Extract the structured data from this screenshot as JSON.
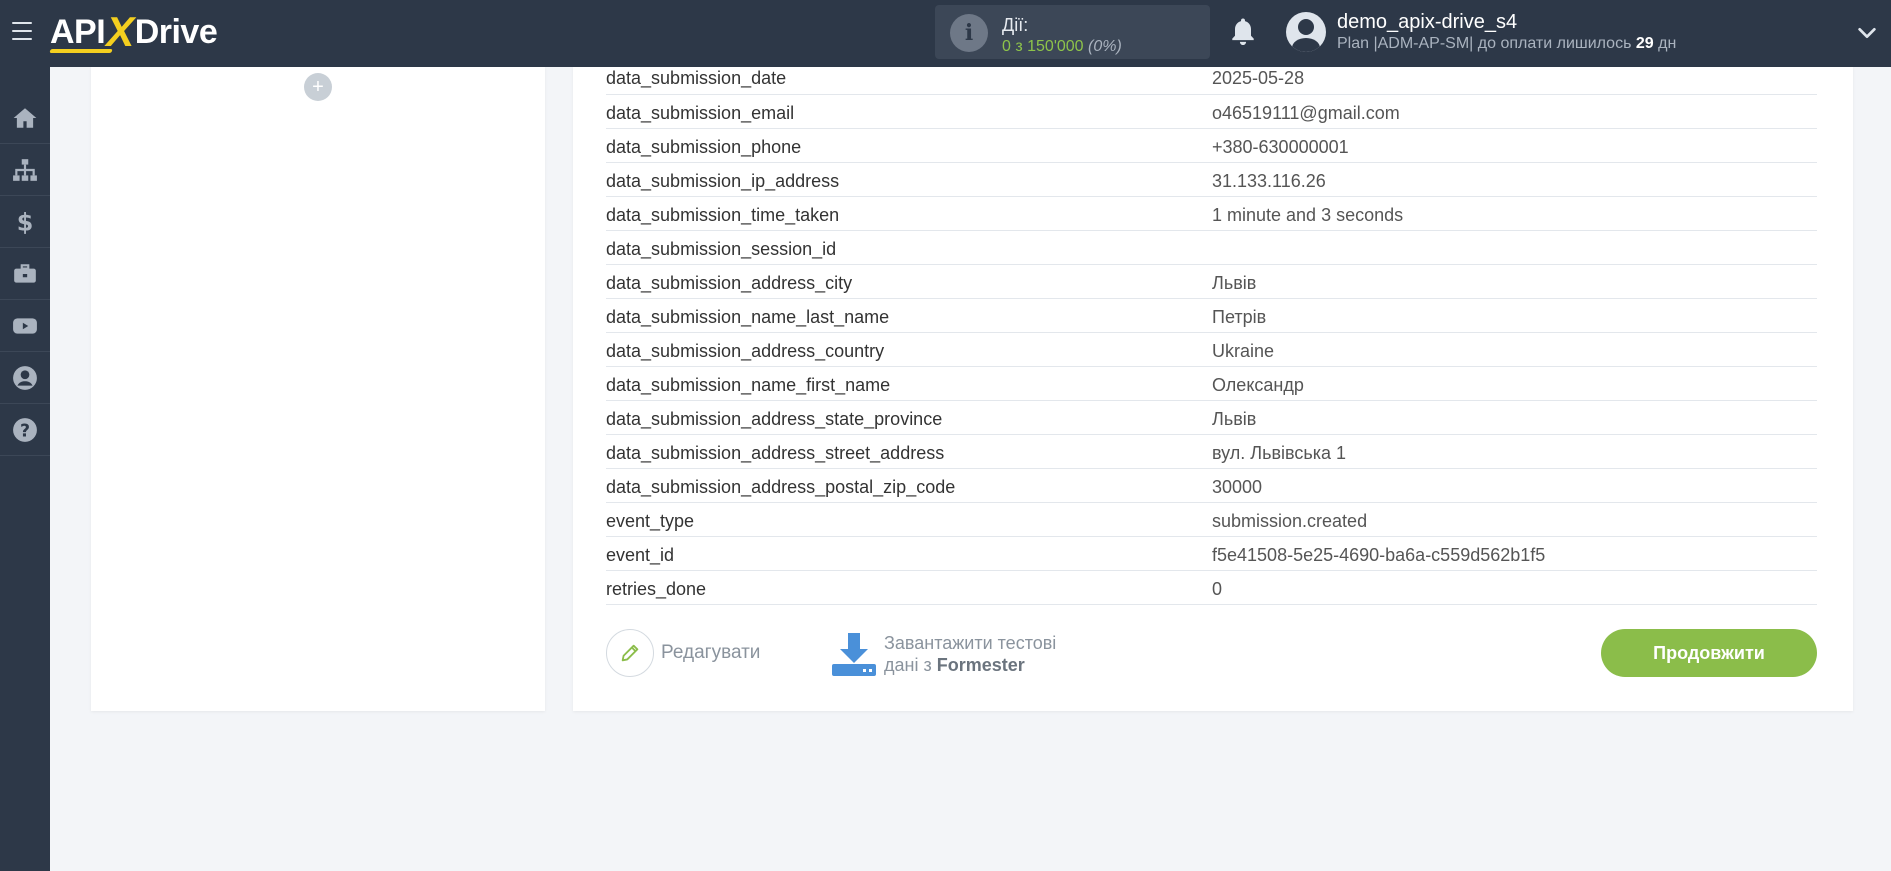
{
  "header": {
    "logo_api": "API",
    "logo_x": "X",
    "logo_drive": "Drive",
    "actions_title": "Дії:",
    "actions_count": "0 з 150'000",
    "actions_percent": "(0%)",
    "username": "demo_apix-drive_s4",
    "plan_prefix": "Plan |ADM-AP-SM| до оплати лишилось ",
    "plan_days": "29",
    "plan_suffix": " дн"
  },
  "sidebar": {
    "items": [
      {
        "icon": "home-icon"
      },
      {
        "icon": "sitemap-icon"
      },
      {
        "icon": "dollar-icon"
      },
      {
        "icon": "briefcase-icon"
      },
      {
        "icon": "youtube-icon"
      },
      {
        "icon": "user-icon"
      },
      {
        "icon": "help-icon"
      }
    ]
  },
  "left_panel": {
    "add_label": "+"
  },
  "table": {
    "rows": [
      {
        "key": "data_submission_date",
        "value": "2025-05-28"
      },
      {
        "key": "data_submission_email",
        "value": "o46519111@gmail.com"
      },
      {
        "key": "data_submission_phone",
        "value": "+380-630000001"
      },
      {
        "key": "data_submission_ip_address",
        "value": "31.133.116.26"
      },
      {
        "key": "data_submission_time_taken",
        "value": "1 minute and 3 seconds"
      },
      {
        "key": "data_submission_session_id",
        "value": ""
      },
      {
        "key": "data_submission_address_city",
        "value": "Львів"
      },
      {
        "key": "data_submission_name_last_name",
        "value": "Петрів"
      },
      {
        "key": "data_submission_address_country",
        "value": "Ukraine"
      },
      {
        "key": "data_submission_name_first_name",
        "value": "Олександр"
      },
      {
        "key": "data_submission_address_state_province",
        "value": "Львів"
      },
      {
        "key": "data_submission_address_street_address",
        "value": "вул. Львівська 1"
      },
      {
        "key": "data_submission_address_postal_zip_code",
        "value": "30000"
      },
      {
        "key": "event_type",
        "value": "submission.created"
      },
      {
        "key": "event_id",
        "value": "f5e41508-5e25-4690-ba6a-c559d562b1f5"
      },
      {
        "key": "retries_done",
        "value": "0"
      }
    ]
  },
  "actions": {
    "edit_label": "Редагувати",
    "download_line1": "Завантажити тестові",
    "download_line2_prefix": "дані з ",
    "download_source": "Formester",
    "continue_label": "Продовжити"
  },
  "colors": {
    "topbar": "#2d3848",
    "accent_green": "#8bbd4a",
    "logo_yellow": "#f4cf1f",
    "download_blue": "#4a90d9"
  }
}
